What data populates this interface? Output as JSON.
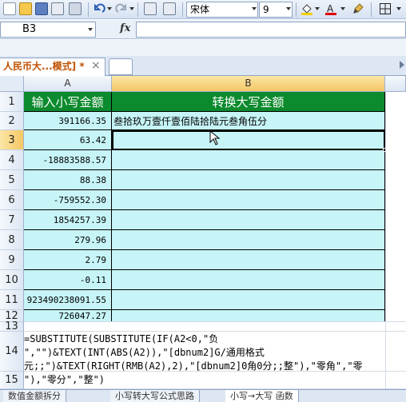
{
  "toolbar": {
    "font_name": "宋体",
    "font_size": "9",
    "icons": [
      "new-file-icon",
      "open-folder-icon",
      "save-icon",
      "print-preview-icon",
      "undo-icon",
      "redo-icon",
      "copy-icon",
      "find-icon",
      "fill-color-icon",
      "font-color-icon",
      "format-brush-icon",
      "borders-icon"
    ],
    "colors": {
      "fill": "#f5d000",
      "font": "#e00000"
    }
  },
  "formula_bar": {
    "cell_ref": "B3",
    "fx": "fx",
    "content": ""
  },
  "document_tab": {
    "title": "人民币大...模式] *",
    "close": "×"
  },
  "grid": {
    "columns": [
      "A",
      "B"
    ],
    "rows": [
      "1",
      "2",
      "3",
      "4",
      "5",
      "6",
      "7",
      "8",
      "9",
      "10",
      "11",
      "12",
      "13",
      "14",
      "15"
    ],
    "header_row": {
      "a": "输入小写金额",
      "b": "转换大写金额"
    },
    "data_rows": [
      {
        "a": "391166.35",
        "b": "叁拾玖万壹仟壹佰陆拾陆元叁角伍分"
      },
      {
        "a": "63.42",
        "b": ""
      },
      {
        "a": "-18883588.57",
        "b": ""
      },
      {
        "a": "88.38",
        "b": ""
      },
      {
        "a": "-759552.30",
        "b": ""
      },
      {
        "a": "1854257.39",
        "b": ""
      },
      {
        "a": "279.96",
        "b": ""
      },
      {
        "a": "2.79",
        "b": ""
      },
      {
        "a": "-0.11",
        "b": ""
      },
      {
        "a": "923490238091.55",
        "b": ""
      },
      {
        "a": "726047.27",
        "b": ""
      }
    ],
    "formula_text": "=SUBSTITUTE(SUBSTITUTE(IF(A2<0,\"负\n\",\"\")&TEXT(INT(ABS(A2)),\"[dbnum2]G/通用格式\n元;;\")&TEXT(RIGHT(RMB(A2),2),\"[dbnum2]0角0分;;整\"),\"零角\",\"零\n\"),\"零分\",\"整\")"
  },
  "sheet_tabs": [
    "数值金额拆分",
    "小写转大写公式思路",
    "小写→大写 函数"
  ],
  "colors": {
    "header_green": "#0c8a2e",
    "cell_cyan": "#c6f4f7",
    "selection_orange": "#f5c765"
  }
}
